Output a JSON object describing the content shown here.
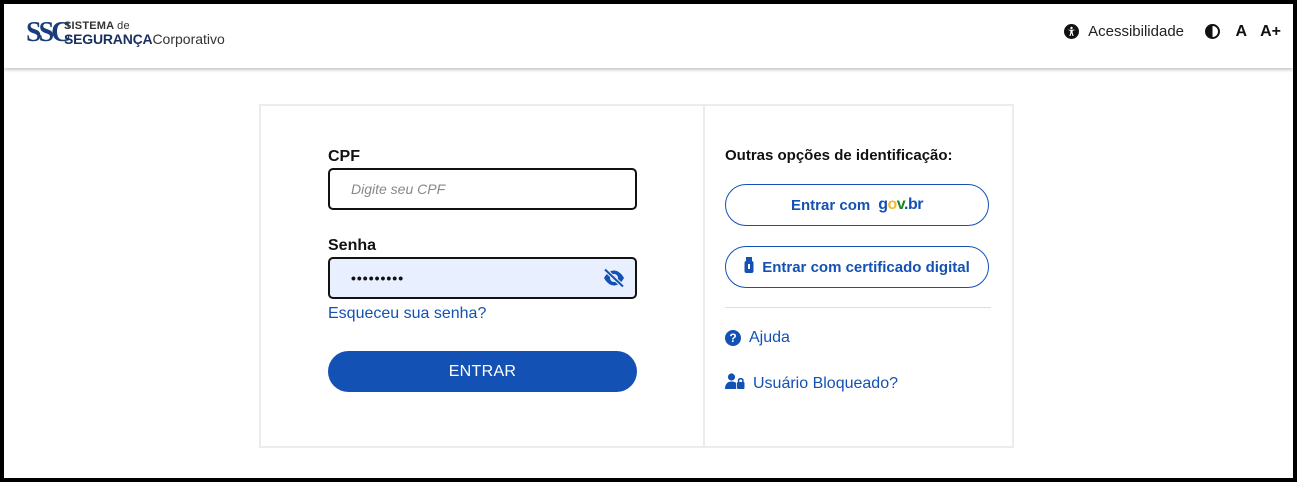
{
  "header": {
    "logo": {
      "mark": "SSC",
      "line1_bold": "SISTEMA",
      "line1_small": "de",
      "line2_bold": "SEGURANÇA",
      "line2_normal": "Corporativo"
    },
    "accessibility_label": "Acessibilidade",
    "font_normal_label": "A",
    "font_increase_label": "A+"
  },
  "login": {
    "cpf_label": "CPF",
    "cpf_placeholder": "Digite seu CPF",
    "password_label": "Senha",
    "password_value": "•••••••••",
    "forgot_password_link": "Esqueceu sua senha?",
    "submit_label": "ENTRAR"
  },
  "other_options": {
    "title": "Outras opções de identificação:",
    "govbr_button_prefix": "Entrar com",
    "govbr_logo": "gov.br",
    "certificate_button": "Entrar com certificado digital",
    "help_link": "Ajuda",
    "blocked_user_link": "Usuário Bloqueado?"
  },
  "colors": {
    "primary": "#1451b4",
    "password_field_bg": "#e8efff",
    "govbr_yellow": "#f2b92b",
    "govbr_green": "#168821"
  },
  "icons": {
    "accessibility": "accessibility-icon",
    "contrast": "contrast-icon",
    "eye": "eye-slash-icon",
    "usb": "usb-token-icon",
    "help": "question-circle-icon",
    "blocked": "user-lock-icon"
  }
}
